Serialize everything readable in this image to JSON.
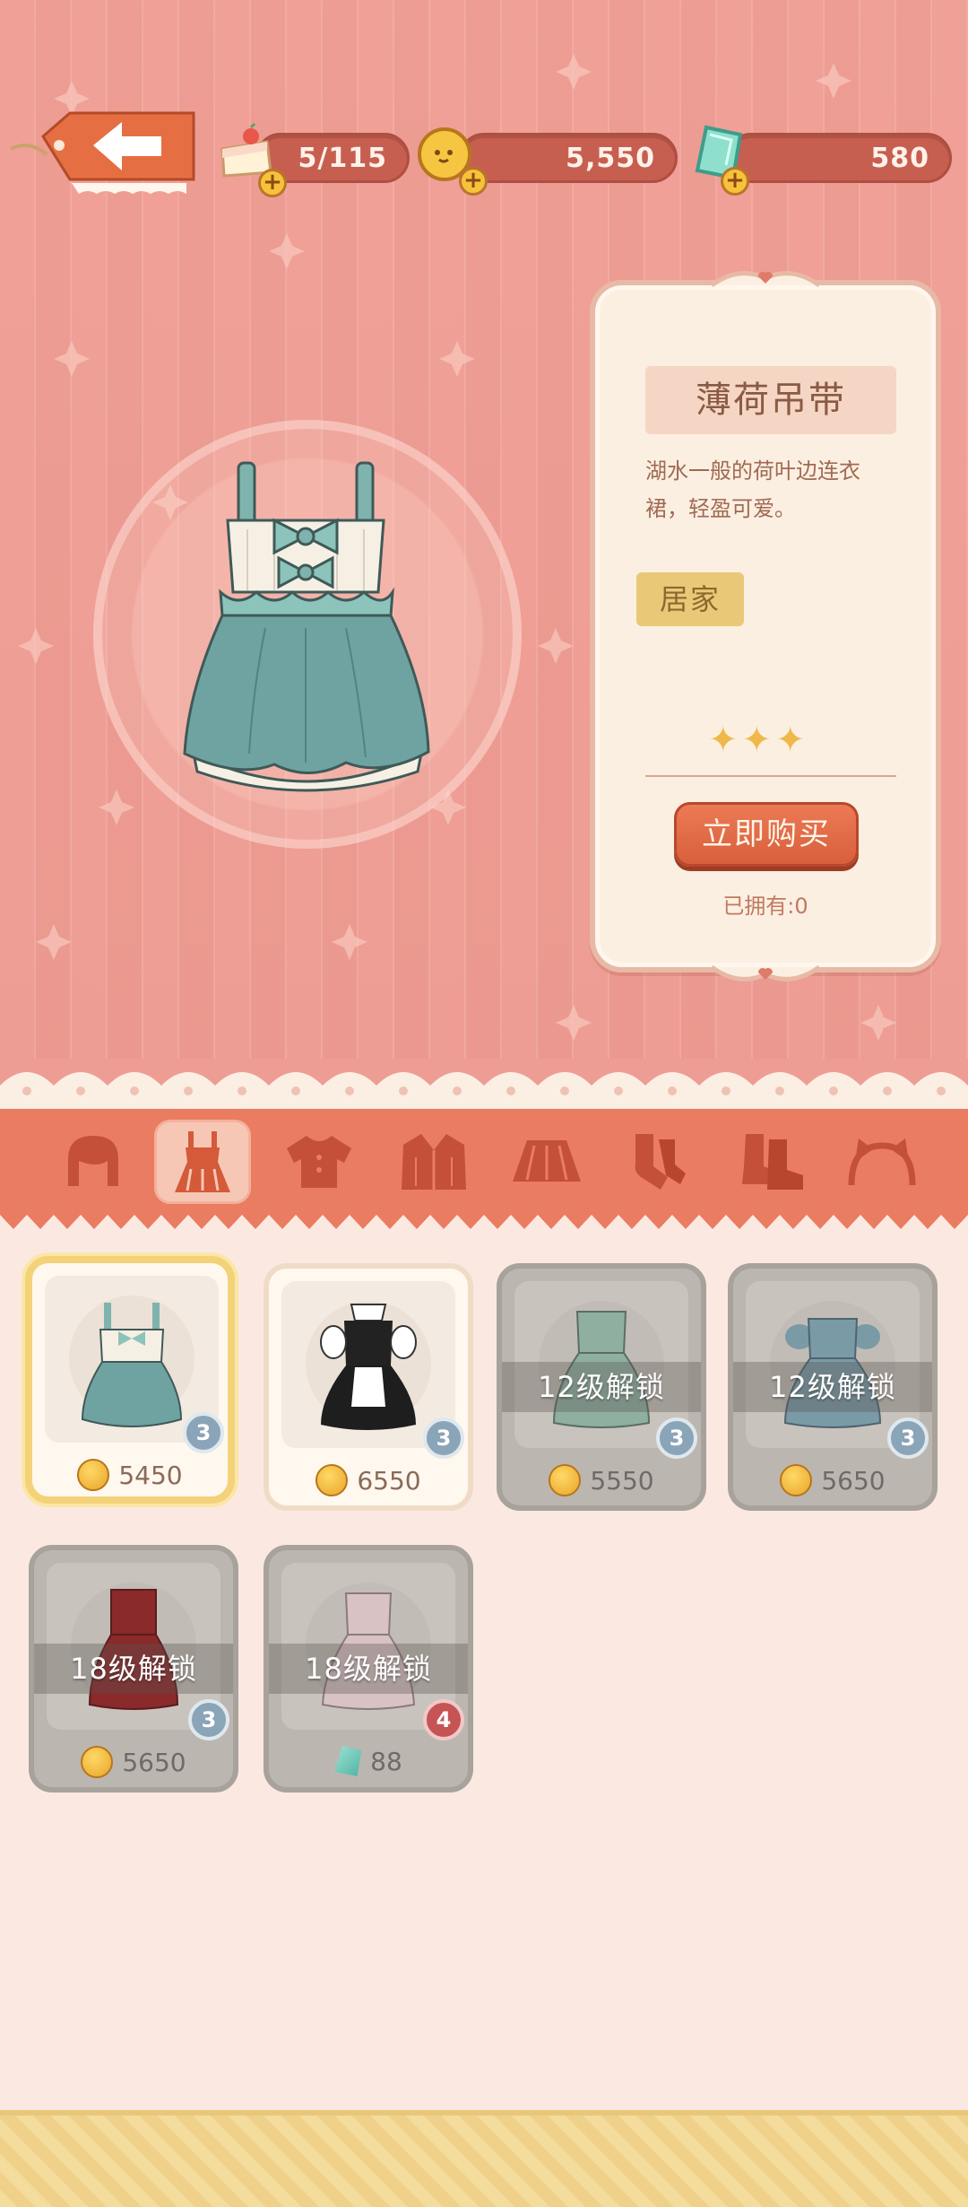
{
  "header": {
    "stamina": "5/115",
    "coins": "5,550",
    "gems": "580"
  },
  "item_detail": {
    "name": "薄荷吊带",
    "description_line1": "湖水一般的荷叶边连衣",
    "description_line2": "裙，轻盈可爱。",
    "tag": "居家",
    "stars": "✦✦✦",
    "buy_label": "立即购买",
    "owned": "已拥有:0"
  },
  "categories": [
    {
      "name": "hair"
    },
    {
      "name": "dress",
      "active": true
    },
    {
      "name": "top"
    },
    {
      "name": "coat"
    },
    {
      "name": "skirt"
    },
    {
      "name": "socks"
    },
    {
      "name": "shoes"
    },
    {
      "name": "accessory"
    }
  ],
  "items": [
    {
      "price": "5450",
      "rarity": "3",
      "state": "selected"
    },
    {
      "price": "6550",
      "rarity": "3",
      "state": "available"
    },
    {
      "price": "5550",
      "rarity": "3",
      "state": "locked",
      "lock_text": "12级解锁"
    },
    {
      "price": "5650",
      "rarity": "3",
      "state": "locked",
      "lock_text": "12级解锁"
    },
    {
      "price": "5650",
      "rarity": "3",
      "state": "locked",
      "lock_text": "18级解锁"
    },
    {
      "price": "88",
      "rarity": "4",
      "state": "locked",
      "lock_text": "18级解锁",
      "currency": "gem"
    }
  ]
}
